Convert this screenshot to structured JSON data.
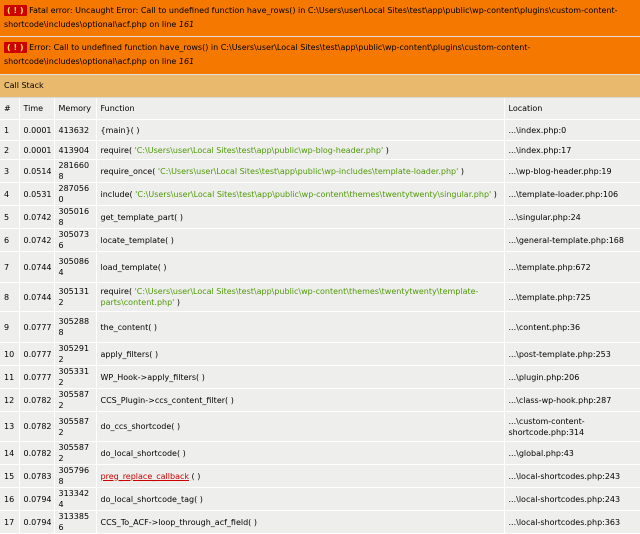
{
  "errors": [
    {
      "badge": "( ! )",
      "prefix": "Fatal error: Uncaught Error: Call to undefined function have_rows() in C:\\Users\\user\\Local Sites\\test\\app\\public\\wp-content\\plugins\\custom-content-shortcode\\includes\\optional\\acf.php on line ",
      "line": "161"
    },
    {
      "badge": "( ! )",
      "prefix": "Error: Call to undefined function have_rows() in C:\\Users\\user\\Local Sites\\test\\app\\public\\wp-content\\plugins\\custom-content-shortcode\\includes\\optional\\acf.php on line ",
      "line": "161"
    }
  ],
  "callstack_title": "Call Stack",
  "headers": {
    "num": "#",
    "time": "Time",
    "memory": "Memory",
    "function": "Function",
    "location": "Location"
  },
  "rows": [
    {
      "n": "1",
      "time": "0.0001",
      "mem": "413632",
      "fn": "{main}( )",
      "arg": "",
      "fn_after": "",
      "loc_file": "...\\index.php",
      "loc_line": ":0",
      "h": 21
    },
    {
      "n": "2",
      "time": "0.0001",
      "mem": "413904",
      "fn": "require( ",
      "arg": "'C:\\Users\\user\\Local Sites\\test\\app\\public\\wp-blog-header.php'",
      "fn_after": " )",
      "loc_file": "...\\index.php",
      "loc_line": ":17",
      "h": 19
    },
    {
      "n": "3",
      "time": "0.0514",
      "mem": "2816608",
      "fn": "require_once( ",
      "arg": "'C:\\Users\\user\\Local Sites\\test\\app\\public\\wp-includes\\template-loader.php'",
      "fn_after": " )",
      "loc_file": "...\\wp-blog-header.php",
      "loc_line": ":19",
      "h": 19
    },
    {
      "n": "4",
      "time": "0.0531",
      "mem": "2870560",
      "fn": "include( ",
      "arg": "'C:\\Users\\user\\Local Sites\\test\\app\\public\\wp-content\\themes\\twentytwenty\\singular.php'",
      "fn_after": " )",
      "loc_file": "...\\template-loader.php",
      "loc_line": ":106",
      "h": 19
    },
    {
      "n": "5",
      "time": "0.0742",
      "mem": "3050168",
      "fn": "get_template_part( )",
      "arg": "",
      "fn_after": "",
      "loc_file": "...\\singular.php",
      "loc_line": ":24",
      "h": 19
    },
    {
      "n": "6",
      "time": "0.0742",
      "mem": "3050736",
      "fn": "locate_template( )",
      "arg": "",
      "fn_after": "",
      "loc_file": "...\\general-template.php",
      "loc_line": ":168",
      "h": 19
    },
    {
      "n": "7",
      "time": "0.0744",
      "mem": "3050864",
      "fn": "load_template( )",
      "arg": "",
      "fn_after": "",
      "loc_file": "...\\template.php",
      "loc_line": ":672",
      "h": 31
    },
    {
      "n": "8",
      "time": "0.0744",
      "mem": "3051312",
      "fn": "require( ",
      "arg": "'C:\\Users\\user\\Local Sites\\test\\app\\public\\wp-content\\themes\\twentytwenty\\template-parts\\content.php'",
      "fn_after": " )",
      "loc_file": "...\\template.php",
      "loc_line": ":725",
      "h": 29
    },
    {
      "n": "9",
      "time": "0.0777",
      "mem": "3052888",
      "fn": "the_content( )",
      "arg": "",
      "fn_after": "",
      "loc_file": "...\\content.php",
      "loc_line": ":36",
      "h": 31
    },
    {
      "n": "10",
      "time": "0.0777",
      "mem": "3052912",
      "fn": "apply_filters( )",
      "arg": "",
      "fn_after": "",
      "loc_file": "...\\post-template.php",
      "loc_line": ":253",
      "h": 19
    },
    {
      "n": "11",
      "time": "0.0777",
      "mem": "3053312",
      "fn": "WP_Hook->apply_filters( )",
      "arg": "",
      "fn_after": "",
      "loc_file": "...\\plugin.php",
      "loc_line": ":206",
      "h": 19
    },
    {
      "n": "12",
      "time": "0.0782",
      "mem": "3055872",
      "fn": "CCS_Plugin->ccs_content_filter( )",
      "arg": "",
      "fn_after": "",
      "loc_file": "...\\class-wp-hook.php",
      "loc_line": ":287",
      "h": 19
    },
    {
      "n": "13",
      "time": "0.0782",
      "mem": "3055872",
      "fn": "do_ccs_shortcode( )",
      "arg": "",
      "fn_after": "",
      "loc_file": "...\\custom-content-shortcode.php",
      "loc_line": ":314",
      "h": 30
    },
    {
      "n": "14",
      "time": "0.0782",
      "mem": "3055872",
      "fn": "do_local_shortcode( )",
      "arg": "",
      "fn_after": "",
      "loc_file": "...\\global.php",
      "loc_line": ":43",
      "h": 19
    },
    {
      "n": "15",
      "time": "0.0783",
      "mem": "3057968",
      "fn": "",
      "link": "preg_replace_callback",
      "fn_after": " ( )",
      "arg": "",
      "loc_file": "...\\local-shortcodes.php",
      "loc_line": ":243",
      "h": 19
    },
    {
      "n": "16",
      "time": "0.0794",
      "mem": "3133424",
      "fn": "do_local_shortcode_tag( )",
      "arg": "",
      "fn_after": "",
      "loc_file": "...\\local-shortcodes.php",
      "loc_line": ":243",
      "h": 19
    },
    {
      "n": "17",
      "time": "0.0794",
      "mem": "3133856",
      "fn": "CCS_To_ACF->loop_through_acf_field( )",
      "arg": "",
      "fn_after": "",
      "loc_file": "...\\local-shortcodes.php",
      "loc_line": ":363",
      "h": 19
    }
  ]
}
